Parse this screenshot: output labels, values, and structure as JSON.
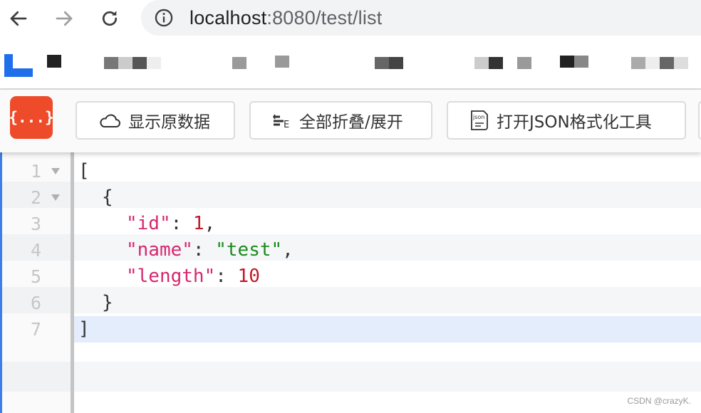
{
  "browser": {
    "url_host": "localhost",
    "url_path": ":8080/test/list"
  },
  "toolbar": {
    "logo_text": "{...}",
    "buttons": [
      {
        "label": "显示原数据",
        "icon": "cloud-icon"
      },
      {
        "label": "全部折叠/展开",
        "icon": "collapse-expand-icon"
      },
      {
        "label": "打开JSON格式化工具",
        "icon": "json-file-icon"
      }
    ]
  },
  "editor": {
    "line_numbers": [
      "1",
      "2",
      "3",
      "4",
      "5",
      "6",
      "7"
    ],
    "code": {
      "l1": "[",
      "l2": "{",
      "l3_key": "\"id\"",
      "l3_colon": ": ",
      "l3_value": "1",
      "l3_comma": ",",
      "l4_key": "\"name\"",
      "l4_colon": ": ",
      "l4_value": "\"test\"",
      "l4_comma": ",",
      "l5_key": "\"length\"",
      "l5_colon": ": ",
      "l5_value": "10",
      "l6": "}",
      "l7": "]"
    }
  },
  "watermark": "CSDN @crazyK.",
  "colors": {
    "json_key": "#d6286f",
    "json_number": "#c0192a",
    "json_string": "#1d8a1f",
    "logo_bg": "#ee4b2b",
    "active_line": "#e3edfb"
  }
}
